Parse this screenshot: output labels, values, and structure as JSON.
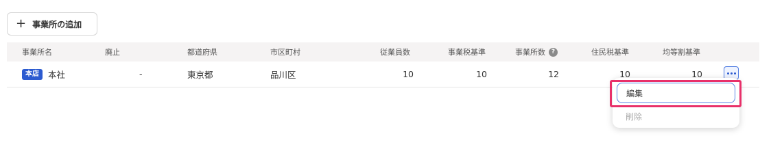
{
  "toolbar": {
    "add_label": "事業所の追加",
    "add_icon": "plus-icon"
  },
  "table": {
    "headers": [
      "事業所名",
      "廃止",
      "都道府県",
      "市区町村",
      "従業員数",
      "事業税基準",
      "事業所数",
      "住民税基準",
      "均等割基準"
    ],
    "rows": [
      {
        "badge": "本店",
        "name": "本社",
        "abolished": "-",
        "prefecture": "東京都",
        "city": "品川区",
        "employees": "10",
        "business_tax_basis": "10",
        "office_count": "12",
        "resident_tax_basis": "10",
        "equal_share_basis": "10"
      }
    ]
  },
  "menu": {
    "edit_label": "編集",
    "delete_label": "削除"
  },
  "colors": {
    "accent": "#2c5bd0",
    "highlight": "#e8306a",
    "header_bg": "#f5f3f3"
  }
}
